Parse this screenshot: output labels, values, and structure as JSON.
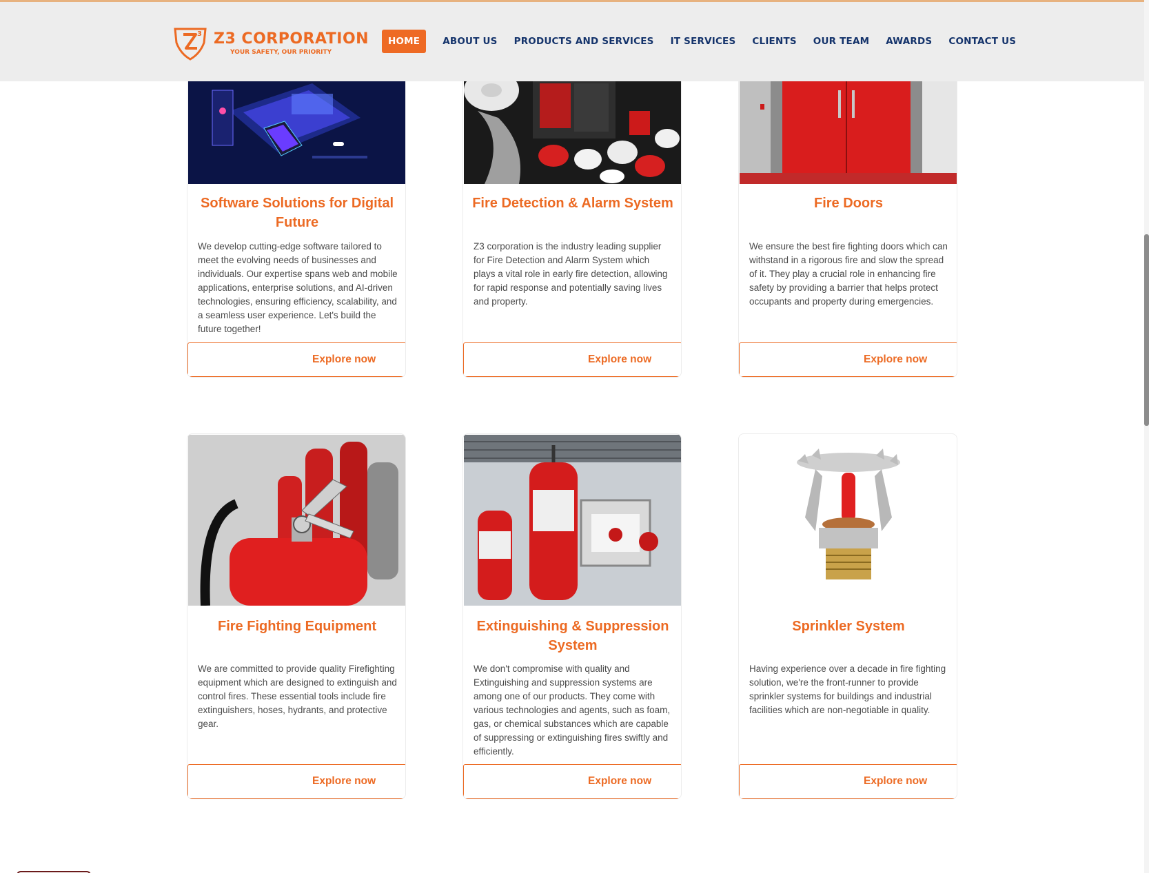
{
  "brand": {
    "name": "Z3 CORPORATION",
    "tagline": "YOUR SAFETY, OUR PRIORITY",
    "accent": "#ec6a23",
    "nav_color": "#14336b"
  },
  "nav": [
    {
      "label": "HOME",
      "active": true
    },
    {
      "label": "ABOUT US"
    },
    {
      "label": "PRODUCTS AND SERVICES"
    },
    {
      "label": "IT SERVICES"
    },
    {
      "label": "CLIENTS"
    },
    {
      "label": "OUR TEAM"
    },
    {
      "label": "AWARDS"
    },
    {
      "label": "CONTACT US"
    }
  ],
  "cards": [
    {
      "title": "Software Solutions for Digital Future",
      "desc": "We develop cutting-edge software tailored to meet the evolving needs of businesses and individuals. Our expertise spans web and mobile applications, enterprise solutions, and AI-driven technologies, ensuring efficiency, scalability, and a seamless user experience. Let's build the future together!",
      "button": "Explore now",
      "image": "software-illustration"
    },
    {
      "title": "Fire Detection & Alarm System",
      "desc": "Z3 corporation is the industry leading supplier for Fire Detection and Alarm System which plays a vital role in early fire detection, allowing for rapid response and potentially saving lives and property.",
      "button": "Explore now",
      "image": "fire-alarm-devices"
    },
    {
      "title": "Fire Doors",
      "desc": "We ensure the best fire fighting doors which can withstand in a rigorous fire and slow the spread of it. They play a crucial role in enhancing fire safety by providing a barrier that helps protect occupants and property during emergencies.",
      "button": "Explore now",
      "image": "red-fire-doors"
    },
    {
      "title": "Fire Fighting Equipment",
      "desc": "We are committed to provide quality Firefighting equipment which are designed to extinguish and control fires. These essential tools include fire extinguishers, hoses, hydrants, and protective gear.",
      "button": "Explore now",
      "image": "fire-extinguishers"
    },
    {
      "title": "Extinguishing & Suppression System",
      "desc": "We don't compromise with quality and Extinguishing and suppression systems are among one of our products. They come with various technologies and agents, such as foam, gas, or chemical substances which are capable of suppressing or extinguishing fires swiftly and efficiently.",
      "button": "Explore now",
      "image": "suppression-cylinders"
    },
    {
      "title": "Sprinkler System",
      "desc": "Having experience over a decade in fire fighting solution, we're the front-runner to provide sprinkler systems for buildings and industrial facilities which are non-negotiable in quality.",
      "button": "Explore now",
      "image": "sprinkler-head"
    }
  ]
}
